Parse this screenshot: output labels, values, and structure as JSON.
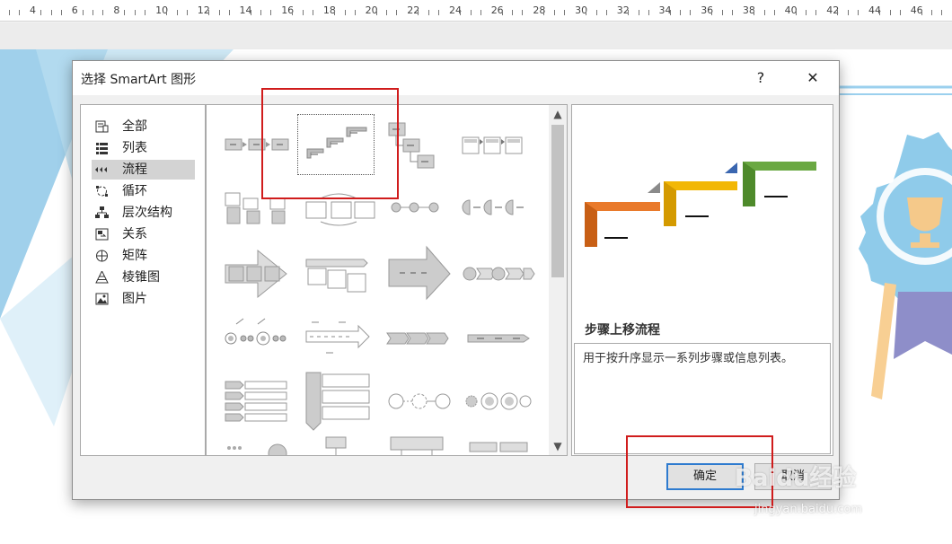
{
  "ruler": {
    "labels": [
      "4",
      "6",
      "8",
      "10",
      "12",
      "14",
      "16",
      "18",
      "20",
      "22",
      "24",
      "26",
      "28",
      "30",
      "32",
      "34",
      "36",
      "38",
      "40",
      "42",
      "44",
      "46",
      "4"
    ]
  },
  "dialog": {
    "title": "选择 SmartArt 图形",
    "help_label": "?",
    "close_label": "✕",
    "categories": [
      {
        "label": "全部",
        "icon": "all-icon"
      },
      {
        "label": "列表",
        "icon": "list-icon"
      },
      {
        "label": "流程",
        "icon": "process-icon",
        "selected": true
      },
      {
        "label": "循环",
        "icon": "cycle-icon"
      },
      {
        "label": "层次结构",
        "icon": "hierarchy-icon"
      },
      {
        "label": "关系",
        "icon": "relationship-icon"
      },
      {
        "label": "矩阵",
        "icon": "matrix-icon"
      },
      {
        "label": "棱锥图",
        "icon": "pyramid-icon"
      },
      {
        "label": "图片",
        "icon": "picture-icon"
      }
    ],
    "scroll_up": "▲",
    "scroll_down": "▼",
    "preview": {
      "name": "步骤上移流程",
      "description": "用于按升序显示一系列步骤或信息列表。"
    },
    "ok_label": "确定",
    "cancel_label": "取消"
  },
  "watermark": {
    "brand": "Baidu经验",
    "url": "jingyan.baidu.com"
  },
  "colors": {
    "selection_red": "#d01c1c",
    "ok_border": "#2e7bcf",
    "step_orange": "#e97a2b",
    "step_yellow": "#f2b705",
    "step_green": "#6aa842"
  }
}
